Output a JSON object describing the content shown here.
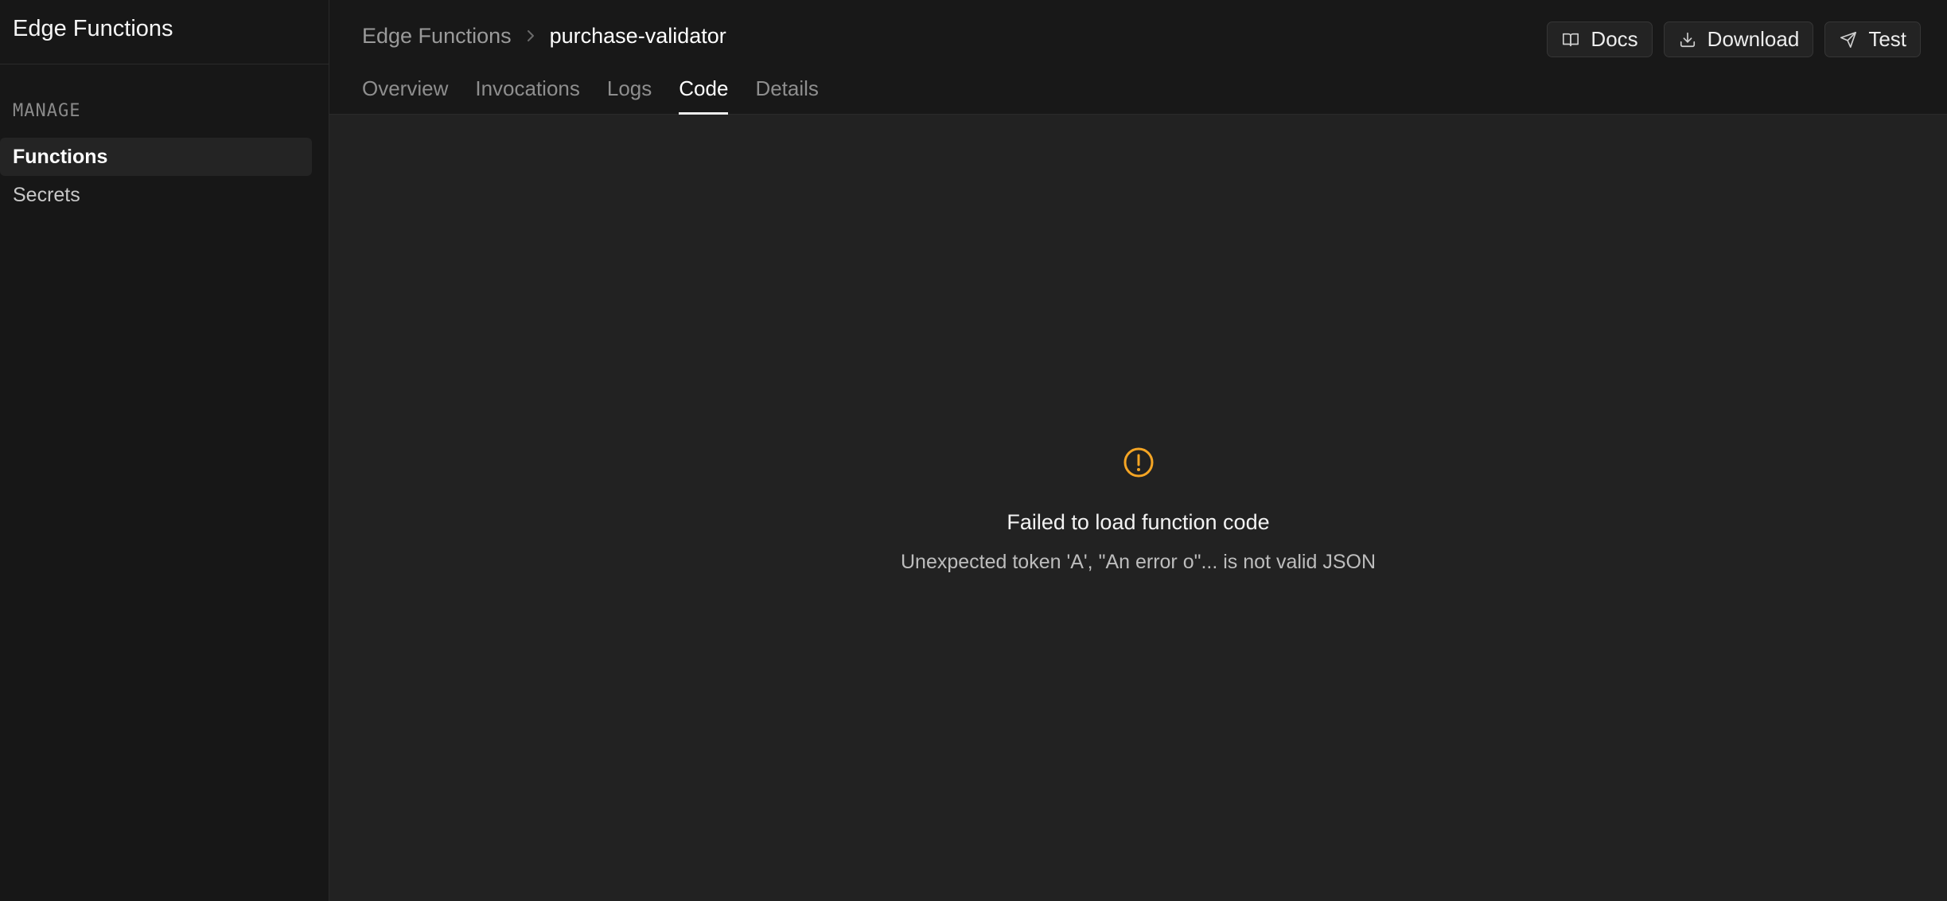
{
  "sidebar": {
    "title": "Edge Functions",
    "section_title": "MANAGE",
    "items": [
      {
        "label": "Functions",
        "active": true
      },
      {
        "label": "Secrets",
        "active": false
      }
    ]
  },
  "header": {
    "breadcrumb_root": "Edge Functions",
    "breadcrumb_current": "purchase-validator",
    "actions": {
      "docs_label": "Docs",
      "download_label": "Download",
      "test_label": "Test"
    },
    "tabs": [
      {
        "label": "Overview",
        "active": false
      },
      {
        "label": "Invocations",
        "active": false
      },
      {
        "label": "Logs",
        "active": false
      },
      {
        "label": "Code",
        "active": true
      },
      {
        "label": "Details",
        "active": false
      }
    ]
  },
  "error": {
    "icon": "warning-circle-icon",
    "title": "Failed to load function code",
    "detail": "Unexpected token 'A', \"An error o\"... is not valid JSON",
    "icon_color": "#f5a524"
  }
}
